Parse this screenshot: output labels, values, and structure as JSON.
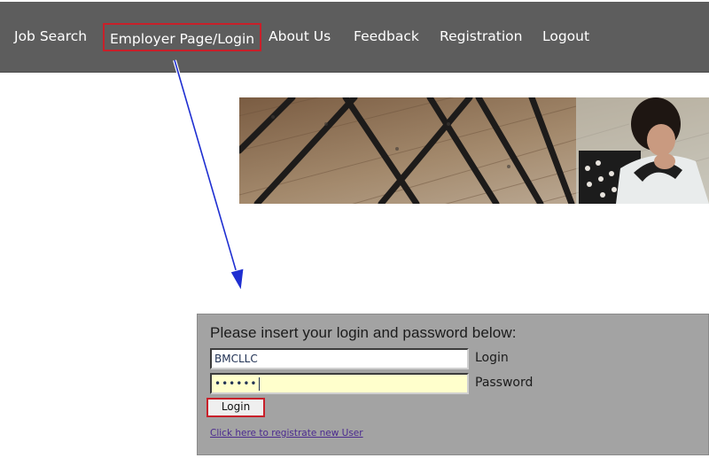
{
  "nav": {
    "items": [
      {
        "label": "Job Search"
      },
      {
        "label": "Employer Page/Login"
      },
      {
        "label": "About Us"
      },
      {
        "label": "Feedback"
      },
      {
        "label": "Registration"
      },
      {
        "label": "Logout"
      }
    ]
  },
  "login_form": {
    "heading": "Please insert your login and password below:",
    "login_value": "BMCLLC",
    "login_label": "Login",
    "password_mask": "••••••",
    "password_label": "Password",
    "submit_label": "Login",
    "register_link": "Click here to registrate new User"
  },
  "colors": {
    "navbar": "#5d5d5d",
    "highlight_box": "#c8202a",
    "arrow": "#1f2fd1",
    "panel": "#a3a3a3",
    "password_field": "#ffffcc"
  }
}
